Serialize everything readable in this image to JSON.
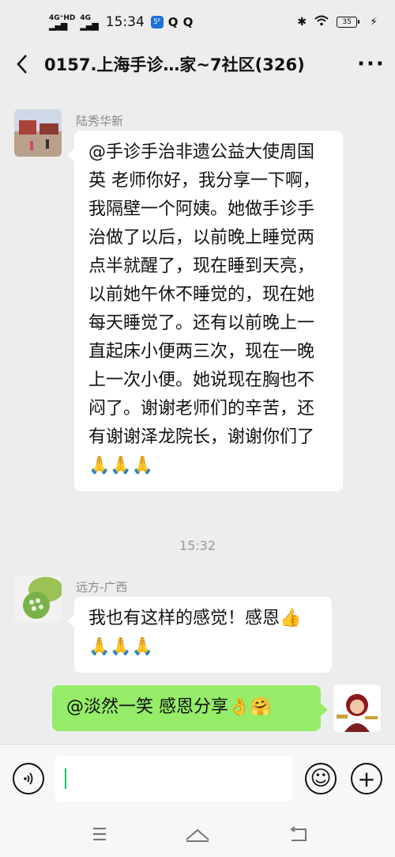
{
  "status_bar": {
    "network1": "4G⁺HD",
    "network2": "4G",
    "time": "15:34",
    "app1": "5ᴱ",
    "q1": "Q",
    "q2": "Q",
    "bluetooth": "✱",
    "wifi": "◠",
    "battery": "35",
    "charging": "⚡"
  },
  "header": {
    "back_icon": "chevron-left-icon",
    "title": "0157.上海手诊…家~7社区(326)",
    "more_label": "···"
  },
  "messages": [
    {
      "sender": "陆秀华新",
      "text": "@手诊手治非遗公益大使周国英 老师你好，我分享一下啊，我隔壁一个阿姨。她做手诊手治做了以后，以前晚上睡觉两点半就醒了，现在睡到天亮，以前她午休不睡觉的，现在她每天睡觉了。还有以前晚上一直起床小便两三次，现在一晚上一次小便。她说现在胸也不闷了。谢谢老师们的辛苦，还有谢谢泽龙院长，谢谢你们了🙏🙏🙏"
    },
    {
      "timestamp": "15:32"
    },
    {
      "sender": "远方-广西",
      "text": "我也有这样的感觉！感恩👍🙏🙏🙏"
    },
    {
      "sender": "self",
      "text": "@淡然一笑 感恩分享👌🤗"
    }
  ],
  "input_bar": {
    "voice_icon": "voice-icon",
    "emoji_icon": "emoji-icon",
    "add_icon": "plus-icon",
    "emoji_glyph": "☺",
    "plus_glyph": "+"
  },
  "nav_bar": {
    "menu_glyph": "☰",
    "home_glyph": "⌂",
    "back_glyph": "↩"
  },
  "colors": {
    "background": "#ededed",
    "self_bubble": "#95ec69",
    "other_bubble": "#ffffff",
    "caret": "#07c160"
  }
}
